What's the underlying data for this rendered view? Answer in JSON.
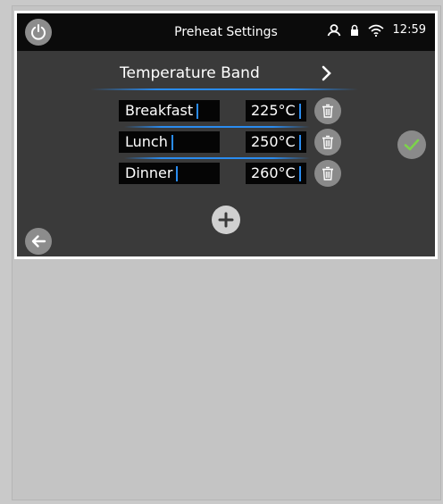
{
  "header": {
    "title": "Preheat Settings",
    "time": "12:59",
    "icons": [
      "power-icon",
      "user-icon",
      "lock-icon",
      "wifi-icon"
    ]
  },
  "band": {
    "label": "Temperature Band"
  },
  "rows": [
    {
      "name": "Breakfast",
      "temp": "225°C"
    },
    {
      "name": "Lunch",
      "temp": "250°C"
    },
    {
      "name": "Dinner",
      "temp": "260°C"
    }
  ],
  "colors": {
    "accent": "#2a8cf0",
    "confirm_check": "#7cd34b",
    "screen_bg": "#3a3a3a",
    "topbar_bg": "#0b0b0b",
    "button_gray": "#8a8a8a"
  }
}
